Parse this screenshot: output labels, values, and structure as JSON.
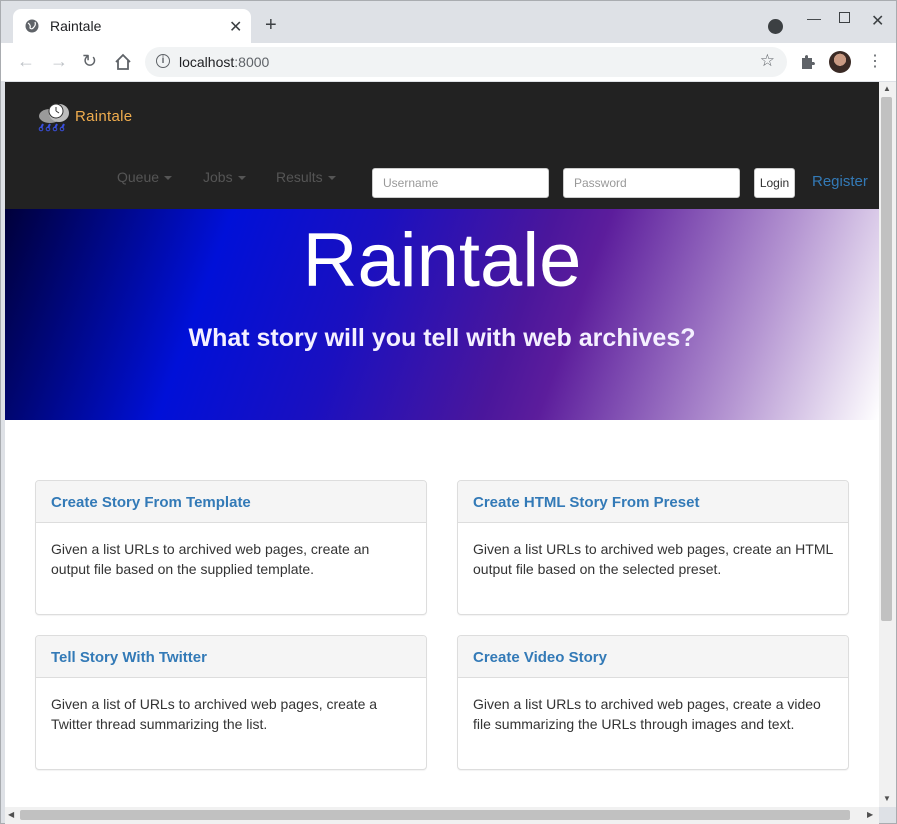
{
  "browser": {
    "tab_title": "Raintale",
    "tab_close": "✕",
    "new_tab": "+",
    "url_host": "localhost",
    "url_port": ":8000",
    "icons": [
      "globe-icon",
      "close-icon",
      "plus-icon",
      "back-icon",
      "forward-icon",
      "reload-icon",
      "home-icon",
      "info-icon",
      "star-icon",
      "puzzle-icon",
      "profile-avatar",
      "kebab-menu-icon",
      "minimize-icon",
      "maximize-icon",
      "window-close-icon"
    ]
  },
  "navbar": {
    "brand": "Raintale",
    "menus": [
      "Queue",
      "Jobs",
      "Results"
    ],
    "username_placeholder": "Username",
    "password_placeholder": "Password",
    "login_label": "Login",
    "register_label": "Register"
  },
  "hero": {
    "title": "Raintale",
    "subtitle": "What story will you tell with web archives?"
  },
  "cards": [
    {
      "title": "Create Story From Template",
      "body": "Given a list URLs to archived web pages, create an output file based on the supplied template."
    },
    {
      "title": "Create HTML Story From Preset",
      "body": "Given a list URLs to archived web pages, create an HTML output file based on the selected preset."
    },
    {
      "title": "Tell Story With Twitter",
      "body": "Given a list of URLs to archived web pages, create a Twitter thread summarizing the list."
    },
    {
      "title": "Create Video Story",
      "body": "Given a list URLs to archived web pages, create a video file summarizing the URLs through images and text."
    }
  ],
  "colors": {
    "navbar_bg": "#222222",
    "brand": "#f0ad4e",
    "link": "#337ab7"
  }
}
